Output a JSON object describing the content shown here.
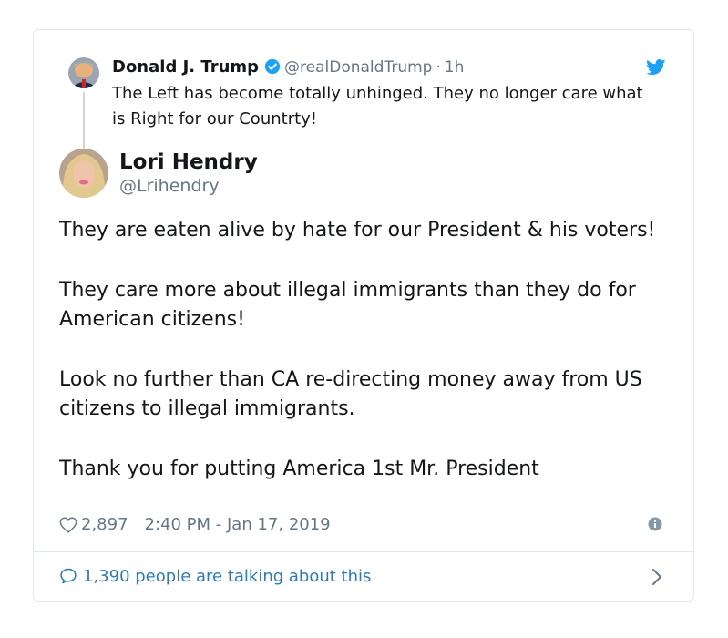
{
  "reply": {
    "name": "Donald J. Trump",
    "handle": "@realDonaldTrump",
    "separator": "·",
    "time_ago": "1h",
    "text": "The Left has become totally unhinged. They no longer care what is Right for our Countrty!"
  },
  "tweet": {
    "name": "Lori Hendry",
    "handle": "@Lrihendry",
    "paragraphs": [
      "They are eaten alive by hate for our President & his voters!",
      "They care more about illegal immigrants than they do for American citizens!",
      "Look no further than CA re-directing money away from US citizens to illegal immigrants.",
      "Thank you for putting America 1st Mr. President"
    ],
    "likes": "2,897",
    "timestamp": "2:40 PM - Jan 17, 2019"
  },
  "footer": {
    "talking_label": "1,390 people are talking about this"
  },
  "icons": {
    "verified": "verified-badge-icon",
    "bird": "twitter-bird-icon",
    "heart": "heart-outline-icon",
    "info": "info-icon",
    "reply_bubble": "speech-bubble-icon",
    "chevron": "chevron-right-icon"
  },
  "colors": {
    "accent": "#1da1f2",
    "link": "#2b7bb9",
    "muted": "#657786",
    "border": "#e1e8ed"
  }
}
